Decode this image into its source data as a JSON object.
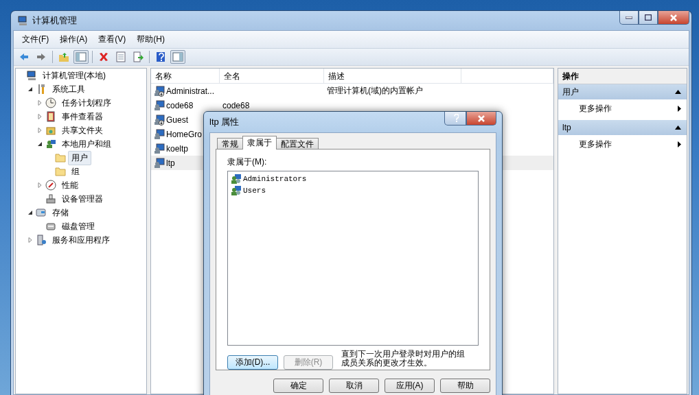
{
  "window": {
    "title": "计算机管理"
  },
  "menu": [
    "文件(F)",
    "操作(A)",
    "查看(V)",
    "帮助(H)"
  ],
  "toolbar": [
    {
      "kind": "back"
    },
    {
      "kind": "forward"
    },
    {
      "kind": "sep"
    },
    {
      "kind": "up"
    },
    {
      "kind": "tree"
    },
    {
      "kind": "sep"
    },
    {
      "kind": "delete"
    },
    {
      "kind": "properties"
    },
    {
      "kind": "export"
    },
    {
      "kind": "sep"
    },
    {
      "kind": "help"
    },
    {
      "kind": "pane"
    }
  ],
  "tree": [
    {
      "label": "计算机管理(本地)",
      "kind": "computer",
      "selected": false,
      "children": [
        {
          "label": "系统工具",
          "kind": "tools",
          "expanded": true,
          "selected": false,
          "children": [
            {
              "label": "任务计划程序",
              "kind": "clock",
              "expanded": false,
              "selected": false
            },
            {
              "label": "事件查看器",
              "kind": "event",
              "expanded": false,
              "selected": false
            },
            {
              "label": "共享文件夹",
              "kind": "share",
              "expanded": false,
              "selected": false
            },
            {
              "label": "本地用户和组",
              "kind": "users",
              "expanded": true,
              "selected": false,
              "children": [
                {
                  "label": "用户",
                  "kind": "folder",
                  "selected": true
                },
                {
                  "label": "组",
                  "kind": "folder",
                  "selected": false
                }
              ]
            },
            {
              "label": "性能",
              "kind": "performance",
              "expanded": false,
              "selected": false
            },
            {
              "label": "设备管理器",
              "kind": "device",
              "selected": false
            }
          ]
        },
        {
          "label": "存储",
          "kind": "storage",
          "expanded": true,
          "selected": false,
          "children": [
            {
              "label": "磁盘管理",
              "kind": "disk",
              "selected": false
            }
          ]
        },
        {
          "label": "服务和应用程序",
          "kind": "services",
          "expanded": false,
          "selected": false
        }
      ]
    }
  ],
  "table": {
    "columns": [
      "名称",
      "全名",
      "描述"
    ],
    "rows": [
      {
        "name": "Administrat...",
        "full_name": "",
        "description": "管理计算机(域)的内置帐户",
        "disabled": true,
        "selected": false
      },
      {
        "name": "code68",
        "full_name": "code68",
        "description": "",
        "disabled": false,
        "selected": false
      },
      {
        "name": "Guest",
        "full_name": "",
        "description": "",
        "disabled": true,
        "selected": false
      },
      {
        "name": "HomeGro",
        "full_name": "",
        "description": "",
        "disabled": false,
        "selected": false
      },
      {
        "name": "koeltp",
        "full_name": "",
        "description": "",
        "disabled": false,
        "selected": false
      },
      {
        "name": "ltp",
        "full_name": "",
        "description": "",
        "disabled": false,
        "selected": true
      }
    ]
  },
  "actions": {
    "title": "操作",
    "sections": [
      {
        "title": "用户",
        "expanded": true,
        "items": [
          "更多操作"
        ]
      },
      {
        "title": "ltp",
        "expanded": true,
        "items": [
          "更多操作"
        ]
      }
    ]
  },
  "dialog": {
    "title": "ltp 属性",
    "tabs": [
      {
        "label": "常规",
        "selected": false
      },
      {
        "label": "隶属于",
        "selected": true
      },
      {
        "label": "配置文件",
        "selected": false
      }
    ],
    "list_label": "隶属于(M):",
    "groups": [
      "Administrators",
      "Users"
    ],
    "buttons": [
      {
        "label": "添加(D)...",
        "disabled": false,
        "focused": true
      },
      {
        "label": "删除(R)",
        "disabled": true,
        "focused": false
      }
    ],
    "note": "直到下一次用户登录时对用户的组成员关系的更改才生效。",
    "footer": [
      "确定",
      "取消",
      "应用(A)",
      "帮助"
    ]
  }
}
